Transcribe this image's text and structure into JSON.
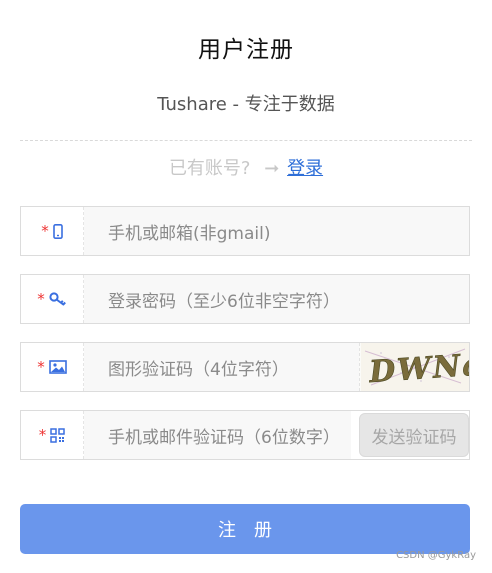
{
  "header": {
    "title": "用户注册",
    "subtitle": "Tushare - 专注于数据"
  },
  "login_prompt": {
    "text": "已有账号?",
    "arrow": "➞",
    "link_label": "登录"
  },
  "form": {
    "phone_email": {
      "placeholder": "手机或邮箱(非gmail)",
      "icon": "phone-icon"
    },
    "password": {
      "placeholder": "登录密码（至少6位非空字符）",
      "icon": "key-icon"
    },
    "captcha": {
      "placeholder": "图形验证码（4位字符）",
      "icon": "image-icon",
      "captcha_text": "DWNa"
    },
    "verify_code": {
      "placeholder": "手机或邮件验证码（6位数字）",
      "icon": "qrcode-icon",
      "send_label": "发送验证码"
    },
    "required_mark": "*"
  },
  "submit": {
    "label": "注册"
  },
  "watermark": "CSDN @GykRay",
  "colors": {
    "accent": "#6a96ec",
    "link": "#2f6fd8",
    "required": "#ee3333",
    "icon_blue": "#3a6fe0"
  }
}
